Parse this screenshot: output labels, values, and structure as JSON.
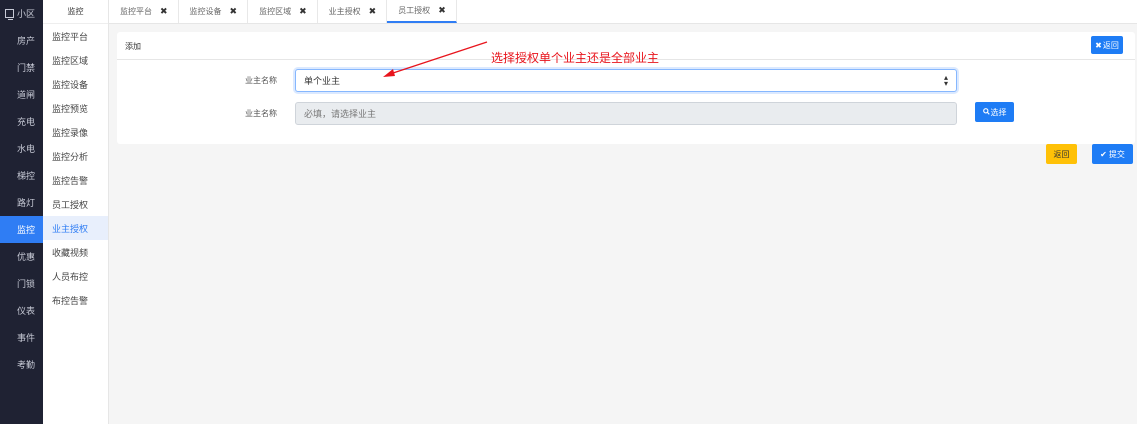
{
  "nav": {
    "items": [
      {
        "label": "小区",
        "icon": "monitor-icon"
      },
      {
        "label": "房产",
        "icon": "grid-icon"
      },
      {
        "label": "门禁",
        "icon": "grid-icon"
      },
      {
        "label": "道闸",
        "icon": "grid-icon"
      },
      {
        "label": "充电",
        "icon": "grid-icon"
      },
      {
        "label": "水电",
        "icon": "grid-icon"
      },
      {
        "label": "梯控",
        "icon": "grid-icon"
      },
      {
        "label": "路灯",
        "icon": "grid-icon"
      },
      {
        "label": "监控",
        "icon": "grid-icon",
        "active": true
      },
      {
        "label": "优惠",
        "icon": "grid-icon"
      },
      {
        "label": "门锁",
        "icon": "grid-icon"
      },
      {
        "label": "仪表",
        "icon": "grid-icon"
      },
      {
        "label": "事件",
        "icon": "grid-icon"
      },
      {
        "label": "考勤",
        "icon": "grid-icon"
      }
    ]
  },
  "submenu": {
    "title": "监控",
    "items": [
      "监控平台",
      "监控区域",
      "监控设备",
      "监控预览",
      "监控录像",
      "监控分析",
      "监控告警",
      "员工授权",
      "业主授权",
      "收藏视频",
      "人员布控",
      "布控告警"
    ],
    "active_index": 8
  },
  "tabs": [
    {
      "label": "监控平台"
    },
    {
      "label": "监控设备"
    },
    {
      "label": "监控区域"
    },
    {
      "label": "业主授权"
    },
    {
      "label": "员工授权",
      "active": true
    }
  ],
  "card": {
    "title": "添加",
    "back_top_label": "返回",
    "field1_label": "业主名称",
    "select_value": "单个业主",
    "field2_label": "业主名称",
    "input_placeholder": "必填，请选择业主",
    "choose_label": "选择"
  },
  "annotation": "选择授权单个业主还是全部业主",
  "actions": {
    "return_label": "返回",
    "submit_label": "提交"
  },
  "colors": {
    "nav_bg": "#1f2233",
    "primary": "#1e7cf5",
    "warning": "#ffc107",
    "annotation": "#e8141c"
  }
}
